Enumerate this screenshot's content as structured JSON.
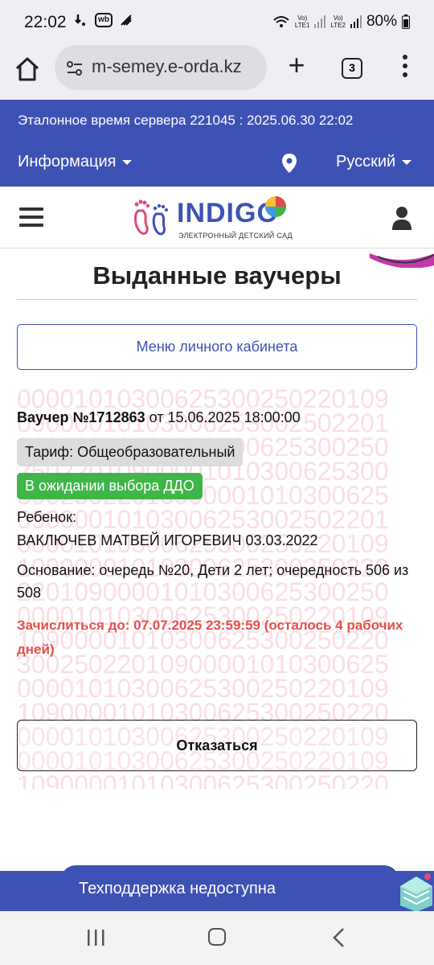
{
  "statusbar": {
    "time": "22:02",
    "wb_label": "wb",
    "battery": "80%",
    "sim1": "LTE1",
    "sim2": "LTE2"
  },
  "browser": {
    "url": "m-semey.e-orda.kz",
    "tab_count": "3"
  },
  "header": {
    "server_time": "Эталонное время сервера 221045 : 2025.06.30 22:02",
    "info_menu": "Информация",
    "language": "Русский",
    "accent_color": "#3d52b5"
  },
  "logo": {
    "brand": "INDIGO",
    "tagline": "ЭЛЕКТРОННЫЙ ДЕТСКИЙ САД"
  },
  "page": {
    "title": "Выданные ваучеры",
    "cabinet_menu_button": "Меню личного кабинета"
  },
  "voucher": {
    "label": "Ваучер №1712863",
    "date": "от 15.06.2025 18:00:00",
    "tariff": "Тариф: Общеобразовательный",
    "status": "В ожидании выбора ДДО",
    "child_label": "Ребенок:",
    "child_name": "ВАКЛЮЧЕВ МАТВЕЙ ИГОРЕВИЧ 03.03.2022",
    "basis": "Основание: очередь №20, Дети 2 лет; очередность 506 из 508",
    "deadline": "Зачислиться до: 07.07.2025 23:59:59 (осталось 4 рабочих дней)",
    "refuse_button": "Отказаться",
    "watermark_lines": [
      "00001010300625300250220109",
      "09000010103006253002502201",
      "22010900001010300625300250",
      "25022010900001010300625300",
      "30025022010900001010300625",
      "09000010103006253002502201",
      "00001010300625300250220109",
      "10900001010300625300250220",
      "22010900001010300625300250",
      "00001010300625300250220109",
      "10900001010300625300250220",
      "30025022010900001010300625",
      "00001010300625300250220109",
      "10900001010300625300250220",
      "00001010300625300250220109",
      "00001010300625300250220109",
      "10900001010300625300250220"
    ]
  },
  "support": {
    "label": "Техподдержка недоступна"
  }
}
